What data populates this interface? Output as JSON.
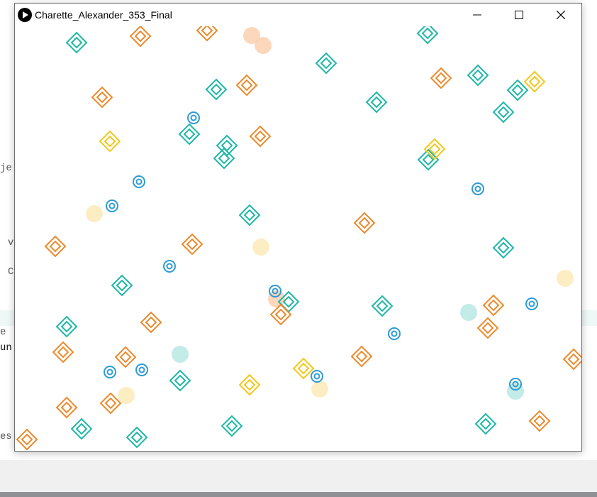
{
  "window": {
    "title": "Charette_Alexander_353_Final",
    "controls": {
      "minimize": "minimize-icon",
      "maximize": "maximize-icon",
      "close": "close-icon"
    }
  },
  "background_editor": {
    "fragments": [
      "je",
      "v",
      "C",
      "e",
      "un",
      "es"
    ]
  },
  "colors": {
    "teal": "#1fb8a6",
    "orange": "#ec8a2c",
    "yellow": "#f2c81e",
    "blue": "#2e9bd6",
    "peach_glow": "#fbd0b0",
    "yellow_glow": "#fbeab8",
    "teal_glow": "#b8e8e3"
  }
}
